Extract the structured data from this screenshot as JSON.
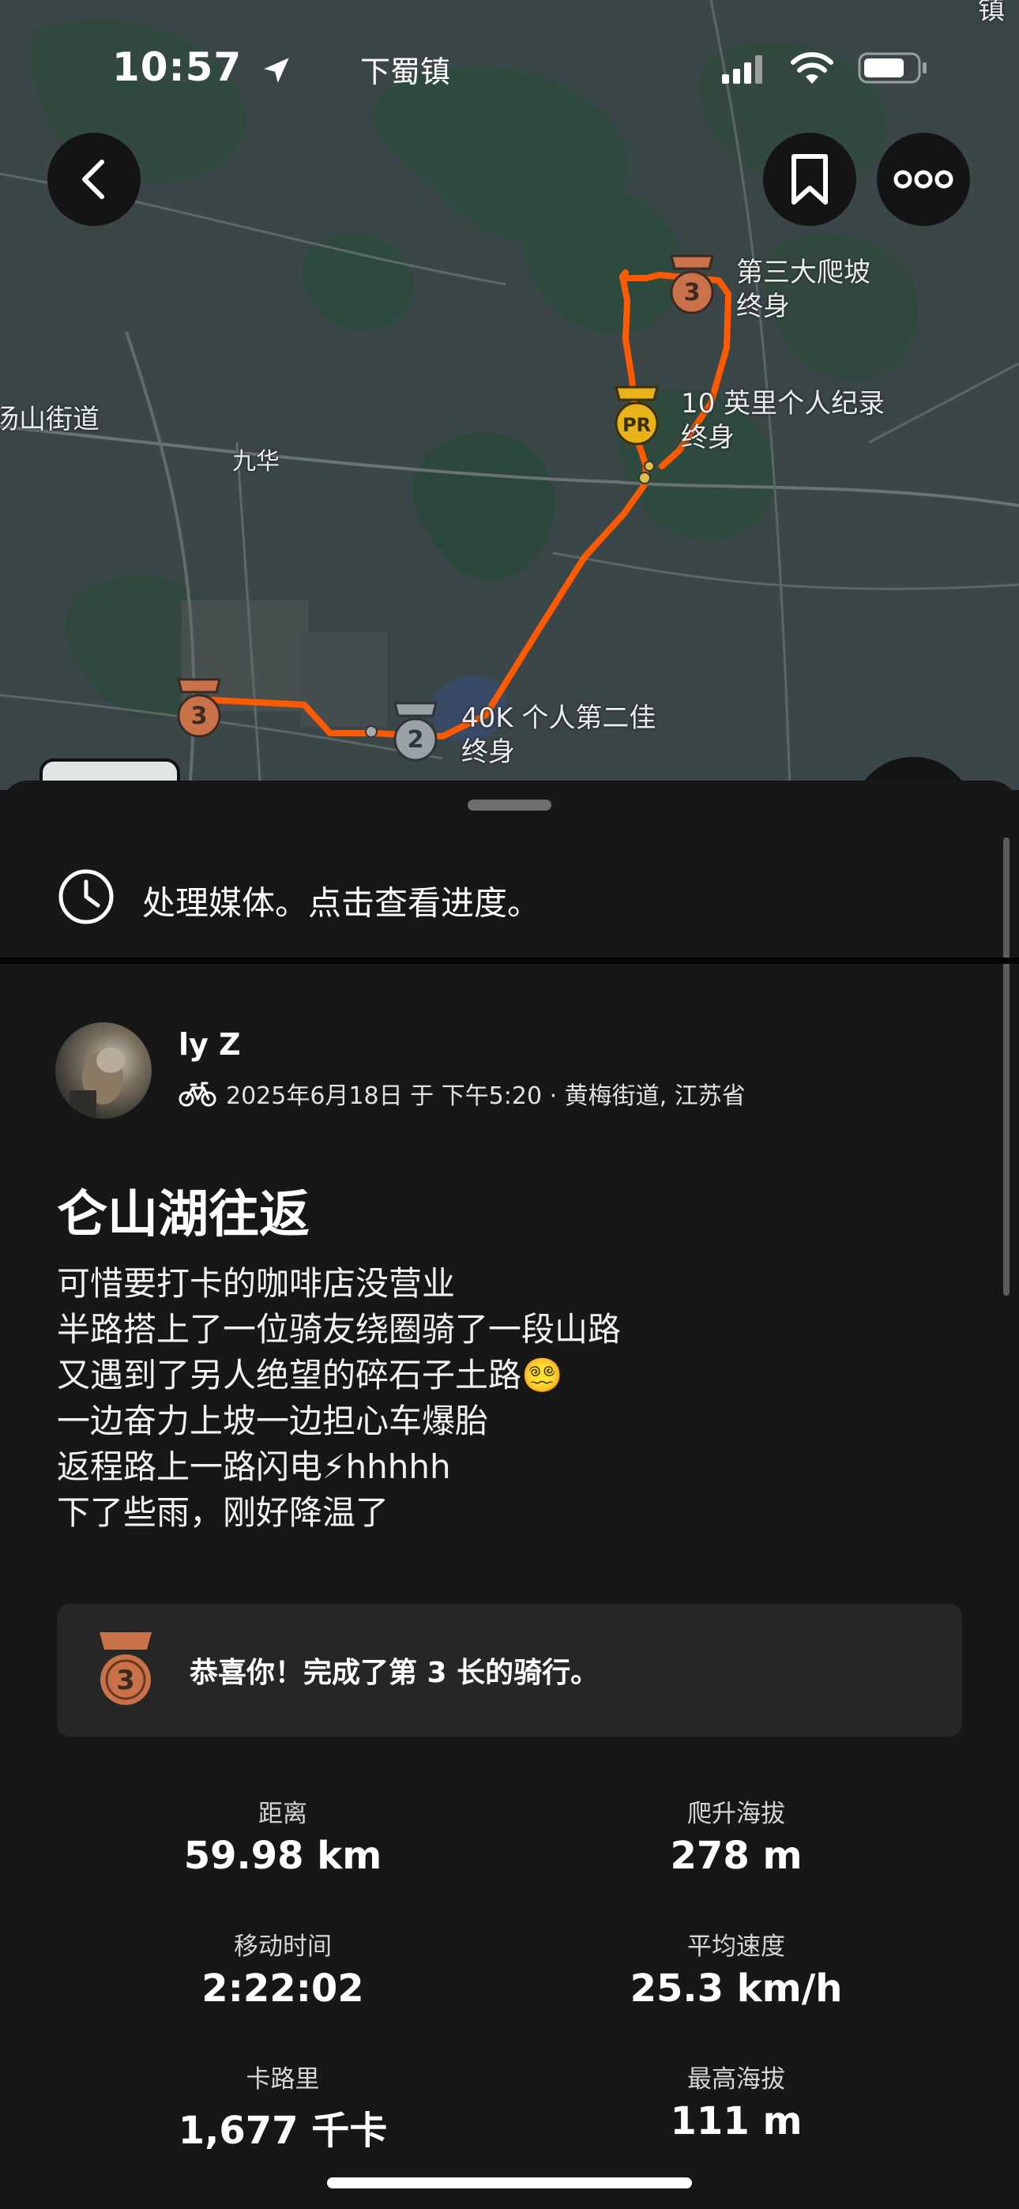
{
  "status_bar": {
    "time": "10:57",
    "place": "下蜀镇",
    "corner_glyph": "镇"
  },
  "map": {
    "labels": {
      "segment_climb": "第三大爬坡",
      "segment_climb_sub": "终身",
      "segment_10mi": "10 英里个人纪录",
      "segment_10mi_sub": "终身",
      "segment_40k": "40K 个人第二佳",
      "segment_40k_sub": "终身",
      "street_left": "汤山街道",
      "town": "九华"
    },
    "route_color": "#ff5a00",
    "medal_bronze_number": "3",
    "medal_silver_number": "2",
    "medal_pr_text": "PR"
  },
  "processing": {
    "text": "处理媒体。点击查看进度。"
  },
  "activity": {
    "user_name": "ly Z",
    "meta": "2025年6月18日 于 下午5:20 · 黄梅街道, 江苏省",
    "title": "仑山湖往返",
    "description": [
      "可惜要打卡的咖啡店没营业",
      "半路搭上了一位骑友绕圈骑了一段山路",
      "又遇到了另人绝望的碎石子土路😵‍💫",
      "一边奋力上坡一边担心车爆胎",
      "返程路上一路闪电⚡hhhhh",
      "下了些雨，刚好降温了"
    ]
  },
  "achievement": {
    "medal_number": "3",
    "text": "恭喜你！完成了第 3 长的骑行。"
  },
  "stats": {
    "distance_label": "距离",
    "distance_value": "59.98 km",
    "elevation_label": "爬升海拔",
    "elevation_value": "278 m",
    "moving_time_label": "移动时间",
    "moving_time_value": "2:22:02",
    "avg_speed_label": "平均速度",
    "avg_speed_value": "25.3 km/h",
    "calories_label": "卡路里",
    "calories_value": "1,677 千卡",
    "max_elevation_label": "最高海拔",
    "max_elevation_value": "111 m"
  },
  "colors": {
    "medal_bronze": "#c9724a",
    "medal_silver": "#9aa1a6",
    "medal_gold": "#e7b319",
    "sheet_background": "#171717"
  }
}
